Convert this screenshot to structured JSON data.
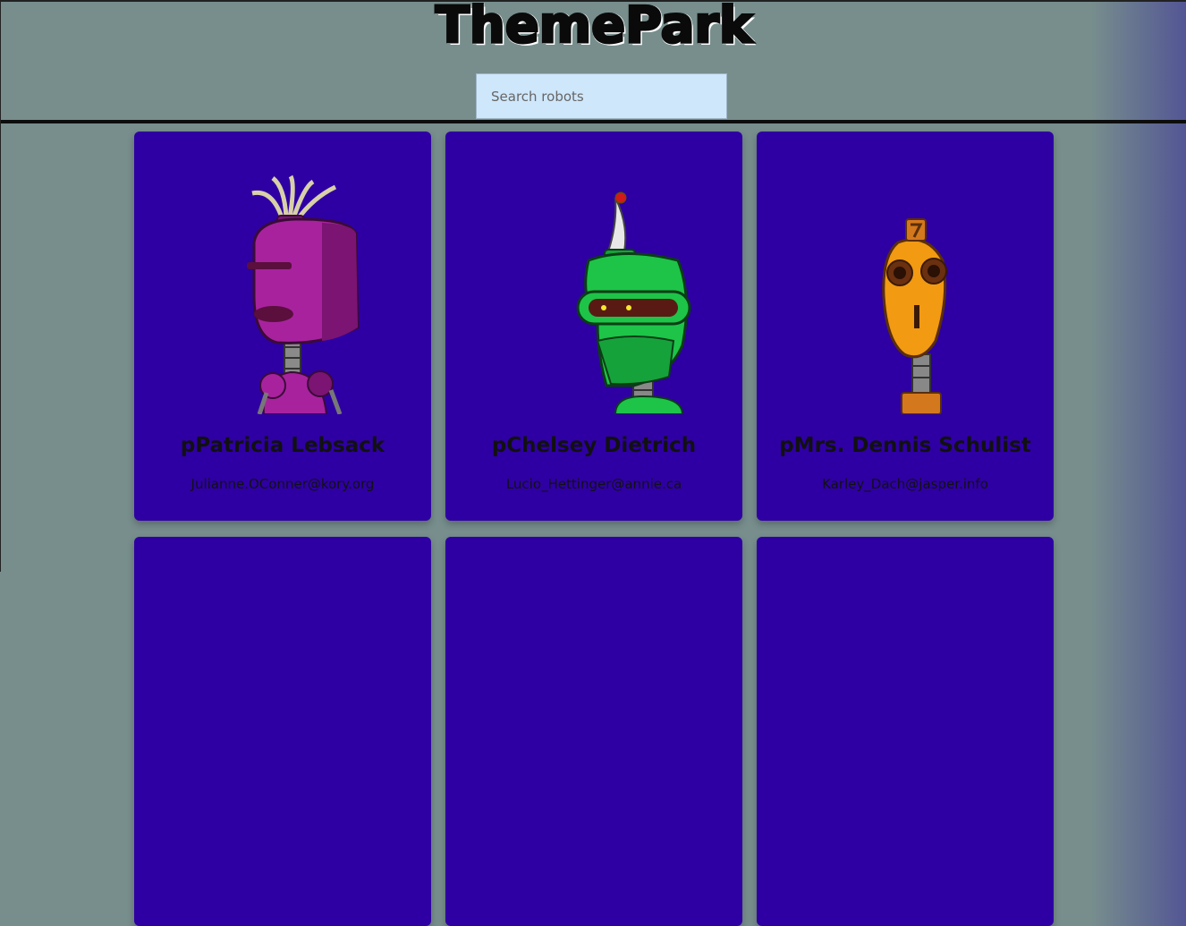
{
  "header": {
    "logo_text": "ThemePark",
    "search_placeholder": "Search robots"
  },
  "robots": [
    {
      "name": "pPatricia Lebsack",
      "email": "Julianne.OConner@kory.org",
      "color": "#a8229e"
    },
    {
      "name": "pChelsey Dietrich",
      "email": "Lucio_Hettinger@annie.ca",
      "color": "#1dc448"
    },
    {
      "name": "pMrs. Dennis Schulist",
      "email": "Karley_Dach@jasper.info",
      "color": "#f19a12"
    }
  ],
  "colors": {
    "card_background": "#2e00a3",
    "page_background": "#778e8d"
  }
}
